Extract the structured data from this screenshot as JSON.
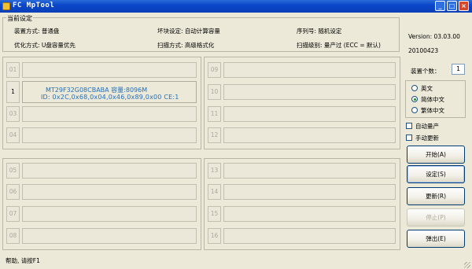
{
  "window": {
    "title": "FC MpTool"
  },
  "settings": {
    "legend": "当前设定",
    "device_mode": "装置方式: 普通盘",
    "bad_block": "坏块设定: 自动计算容量",
    "serial": "序列号: 随机设定",
    "optimize": "优化方式: U盘容量优先",
    "scan_mode": "扫描方式: 高级格式化",
    "scan_level": "扫描级别: 量产过 (ECC = 默认)"
  },
  "info": {
    "version": "Version: 03.03.00",
    "date": "20100423",
    "device_count_label": "装置个数：",
    "device_count": "1"
  },
  "language": {
    "options": [
      "英文",
      "简体中文",
      "繁体中文"
    ],
    "selected": 1
  },
  "options": {
    "auto_mass": "自动量产",
    "manual_update": "手动更新"
  },
  "buttons": {
    "start": "开始(A)",
    "settings": "设定(S)",
    "update": "更新(R)",
    "stop": "停止(P)",
    "eject": "弹出(E)"
  },
  "slots": {
    "s01": "01",
    "s02": "1",
    "s03": "03",
    "s04": "04",
    "s05": "05",
    "s06": "06",
    "s07": "07",
    "s08": "08",
    "s09": "09",
    "s10": "10",
    "s11": "11",
    "s12": "12",
    "s13": "13",
    "s14": "14",
    "s15": "15",
    "s16": "16",
    "active_line1": "MT29F32G08CBABA 容量:8096M",
    "active_line2": "ID: 0x2C,0x68,0x04,0x46,0x89,0x00  CE:1"
  },
  "statusbar": {
    "text": "帮助, 请按F1"
  },
  "colors": {
    "title_bar": "#0a47c9",
    "info_text": "#1f6fc0",
    "face": "#ece9d8"
  }
}
